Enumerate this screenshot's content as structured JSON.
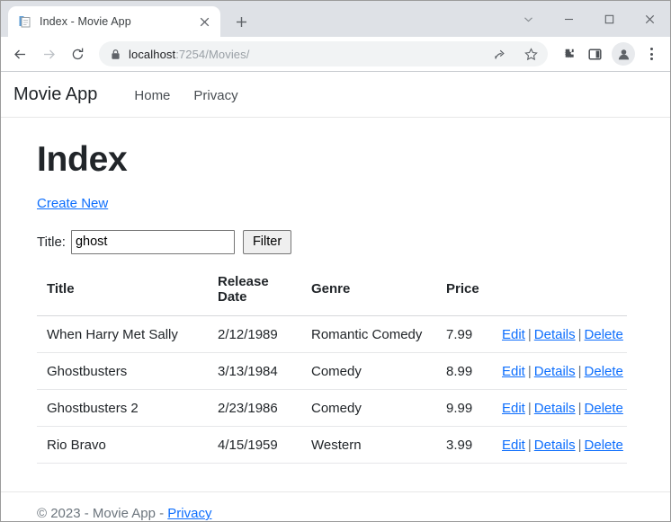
{
  "browser": {
    "tab": {
      "title": "Index - Movie App",
      "favicon_icon": "page-document-icon",
      "close_icon": "✕"
    },
    "new_tab_icon": "+",
    "window_controls": [
      {
        "name": "minimize-to-tray-chevron",
        "glyph": "⌄"
      },
      {
        "name": "minimize",
        "glyph": "–"
      },
      {
        "name": "maximize",
        "glyph": "□"
      },
      {
        "name": "close",
        "glyph": "✕"
      }
    ],
    "nav": {
      "back_icon": "←",
      "forward_icon": "→",
      "reload_icon": "⟳"
    },
    "omnibox": {
      "lock_icon": "lock-icon",
      "url_host": "localhost",
      "url_path": ":7254/Movies/",
      "url_full": "localhost:7254/Movies/",
      "share_icon": "share-icon",
      "bookmark_icon": "star-icon"
    },
    "toolbar_icons": [
      {
        "name": "extensions-puzzle-icon"
      },
      {
        "name": "side-panel-icon"
      },
      {
        "name": "profile-avatar-icon"
      },
      {
        "name": "chrome-menu-kebab-icon"
      }
    ]
  },
  "site": {
    "brand": "Movie App",
    "nav_links": [
      {
        "label": "Home"
      },
      {
        "label": "Privacy"
      }
    ]
  },
  "page": {
    "title": "Index",
    "create_link": "Create New",
    "filter": {
      "label": "Title:",
      "value": "ghost",
      "placeholder": "",
      "button": "Filter"
    },
    "table": {
      "headers": [
        "Title",
        "Release Date",
        "Genre",
        "Price",
        ""
      ],
      "rows": [
        {
          "title": "When Harry Met Sally",
          "release_date": "2/12/1989",
          "genre": "Romantic Comedy",
          "price": "7.99",
          "actions": [
            "Edit",
            "Details",
            "Delete"
          ]
        },
        {
          "title": "Ghostbusters",
          "release_date": "3/13/1984",
          "genre": "Comedy",
          "price": "8.99",
          "actions": [
            "Edit",
            "Details",
            "Delete"
          ]
        },
        {
          "title": "Ghostbusters 2",
          "release_date": "2/23/1986",
          "genre": "Comedy",
          "price": "9.99",
          "actions": [
            "Edit",
            "Details",
            "Delete"
          ]
        },
        {
          "title": "Rio Bravo",
          "release_date": "4/15/1959",
          "genre": "Western",
          "price": "3.99",
          "actions": [
            "Edit",
            "Details",
            "Delete"
          ]
        }
      ],
      "action_separator": "|"
    }
  },
  "footer": {
    "prefix": "© 2023 - Movie App - ",
    "link": "Privacy"
  },
  "colors": {
    "link": "#0d6efd",
    "text": "#212529",
    "muted": "#6c757d",
    "tabstrip": "#dee1e6",
    "omnibox": "#f1f3f4"
  }
}
